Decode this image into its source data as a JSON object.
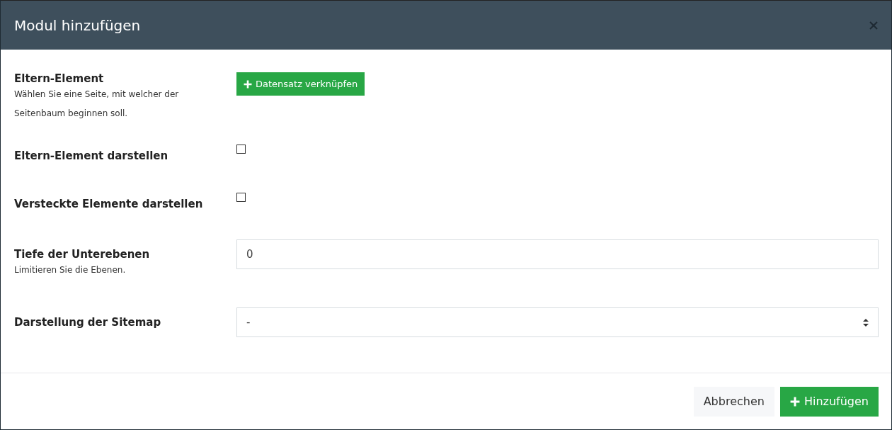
{
  "dialog": {
    "title": "Modul hinzufügen"
  },
  "fields": [
    {
      "kind": "button",
      "label": "Eltern-Element",
      "help": "Wählen Sie eine Seite, mit welcher der Seitenbaum beginnen soll.",
      "button_label": "Datensatz verknüpfen"
    },
    {
      "kind": "checkbox",
      "label": "Eltern-Element darstellen",
      "checked": false
    },
    {
      "kind": "checkbox",
      "label": "Versteckte Elemente darstellen",
      "checked": false
    },
    {
      "kind": "input",
      "label": "Tiefe der Unterebenen",
      "help": "Limitieren Sie die Ebenen.",
      "value": "0"
    },
    {
      "kind": "select",
      "label": "Darstellung der Sitemap",
      "value": "-"
    }
  ],
  "footer": {
    "cancel": "Abbrechen",
    "submit": "Hinzufügen"
  }
}
